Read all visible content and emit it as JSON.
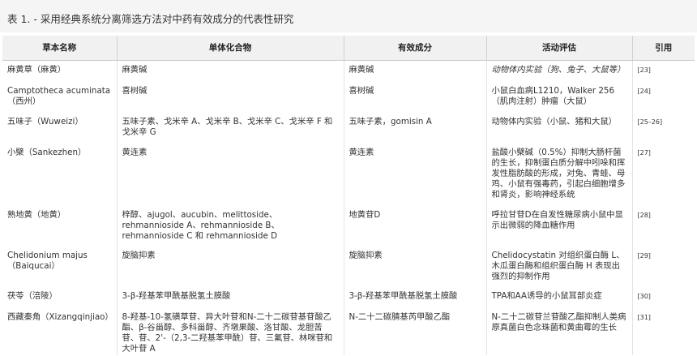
{
  "caption": "表 1. - 采用经典系统分离筛选方法对中药有效成分的代表性研究",
  "headers": [
    "草本名称",
    "单体化合物",
    "有效成分",
    "活动评估",
    "引用"
  ],
  "rows": [
    {
      "herb": "麻黄草（麻黄）",
      "compounds": "麻黄碱",
      "active": "麻黄碱",
      "eval": "动物体内实验（狗、兔子、大鼠等）",
      "ref": "[23]"
    },
    {
      "herb": "Camptotheca acuminata（西州）",
      "compounds": "喜树碱",
      "active": "喜树碱",
      "eval": "小鼠白血病L1210，Walker 256（肌肉注射）肿瘤（大鼠）",
      "ref": "[24]"
    },
    {
      "herb": "五味子（Wuweizi）",
      "compounds": "五味子素、戈米辛 A、戈米辛 B、戈米辛 C、戈米辛 F 和戈米辛 G",
      "active": "五味子素，gomisin A",
      "eval": "动物体内实验（小鼠、猪和大鼠）",
      "ref": "[25–26]"
    },
    {
      "herb": "小檗（Sankezhen）",
      "compounds": "黄连素",
      "active": "黄连素",
      "eval": "盐酸小檗碱（0.5%）抑制大肠杆菌的生长，抑制蛋白质分解中吲哚和挥发性脂肪酸的形成，对兔、青蛙、母鸡、小鼠有强毒药，引起白细胞增多和肾炎，影响神经系统",
      "ref": "[27]"
    },
    {
      "herb": "熟地黄（地黄）",
      "compounds": "梓醇、ajugol、aucubin、melittoside、rehmannioside A、rehmannioside B、rehmannioside C 和 rehmannioside D",
      "active": "地黄苷D",
      "eval": "呼拉甘苷D在自发性糖尿病小鼠中显示出微弱的降血糖作用",
      "ref": "[28]"
    },
    {
      "herb": "Chelidonium majus（Baiqucai）",
      "compounds": "旋脑抑素",
      "active": "旋脑抑素",
      "eval": "Chelidocystatin 对组织蛋白酶 L、木瓜蛋白酶和组织蛋白酶 H 表现出强烈的抑制作用",
      "ref": "[29]"
    },
    {
      "herb": "茯苓（涪陵）",
      "compounds": "3-β-羟基苯甲酰基脱氢土膜酸",
      "active": "3-β-羟基苯甲酰基脱氢土膜酸",
      "eval": "TPA和AA诱导的小鼠耳部炎症",
      "ref": "[30]"
    },
    {
      "herb": "西藏秦角（Xizangqinjiao）",
      "compounds": "8-羟基-10-氢磺草苷、异大叶苷和N-二十二碳苷基苷酸乙酯、β-谷甾醇、多科甾醇、齐墩果酸、洛甘酸、龙胆苦苷、苷、2'-（2,3-二羟基苯甲酰）苷、三氟苷、林咪苷和大叶苷 A",
      "active": "N-二十二碳腈基芮甲酸乙酯",
      "eval": "N-二十二碳苷兰苷酸乙酯抑制人类病原真菌白色念珠菌和黄曲霉的生长",
      "ref": "[31]"
    }
  ]
}
